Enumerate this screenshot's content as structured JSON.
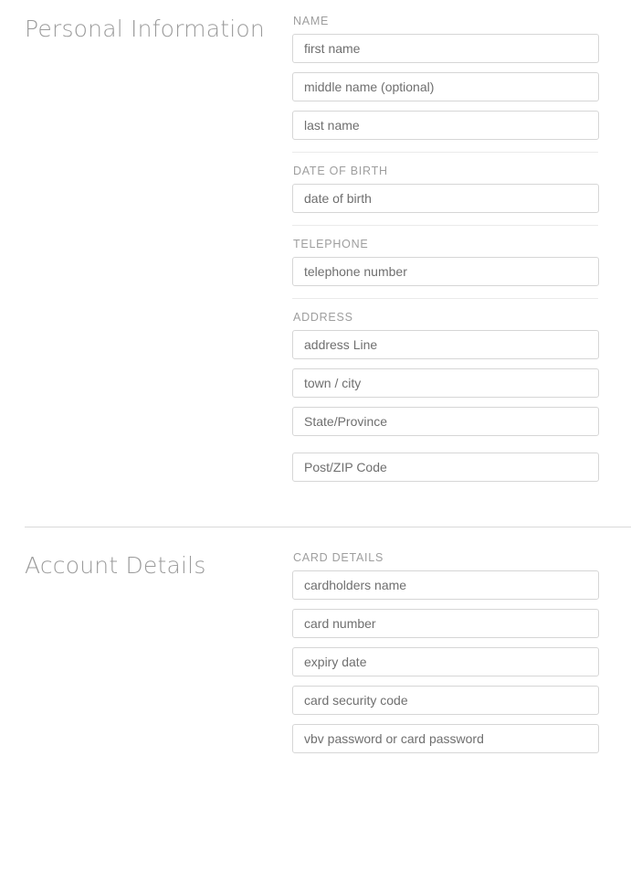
{
  "form": {
    "sections": [
      {
        "id": "personal-information",
        "title": "Personal Information",
        "groups": [
          {
            "id": "name",
            "label": "NAME",
            "fields": [
              {
                "id": "first-name",
                "placeholder": "first name",
                "value": ""
              },
              {
                "id": "middle-name",
                "placeholder": "middle name (optional)",
                "value": ""
              },
              {
                "id": "last-name",
                "placeholder": "last name",
                "value": ""
              }
            ]
          },
          {
            "id": "date-of-birth",
            "label": "DATE OF BIRTH",
            "fields": [
              {
                "id": "date-of-birth",
                "placeholder": "date of birth",
                "value": ""
              }
            ]
          },
          {
            "id": "telephone",
            "label": "TELEPHONE",
            "fields": [
              {
                "id": "telephone-number",
                "placeholder": "telephone number",
                "value": ""
              }
            ]
          },
          {
            "id": "address",
            "label": "ADDRESS",
            "fields": [
              {
                "id": "address-line",
                "placeholder": "address Line",
                "value": ""
              },
              {
                "id": "town-city",
                "placeholder": "town / city",
                "value": ""
              },
              {
                "id": "state-province",
                "placeholder": "State/Province",
                "value": ""
              },
              {
                "id": "post-zip-code",
                "placeholder": "Post/ZIP Code",
                "value": ""
              }
            ]
          }
        ]
      },
      {
        "id": "account-details",
        "title": "Account Details",
        "groups": [
          {
            "id": "card-details",
            "label": "CARD DETAILS",
            "fields": [
              {
                "id": "cardholders-name",
                "placeholder": "cardholders name",
                "value": ""
              },
              {
                "id": "card-number",
                "placeholder": "card number",
                "value": ""
              },
              {
                "id": "expiry-date",
                "placeholder": "expiry date",
                "value": ""
              },
              {
                "id": "card-security-code",
                "placeholder": "card security code",
                "value": ""
              },
              {
                "id": "vbv-password",
                "placeholder": "vbv password or card password",
                "value": ""
              }
            ]
          }
        ]
      }
    ]
  },
  "colors": {
    "heading": "#9b9b9b",
    "label": "#9e9e9e",
    "placeholder": "#6f6f6f",
    "input_border": "#d6d6d6",
    "divider_minor": "#eaeaea",
    "divider_major": "#d9d9d9",
    "background": "#ffffff"
  }
}
